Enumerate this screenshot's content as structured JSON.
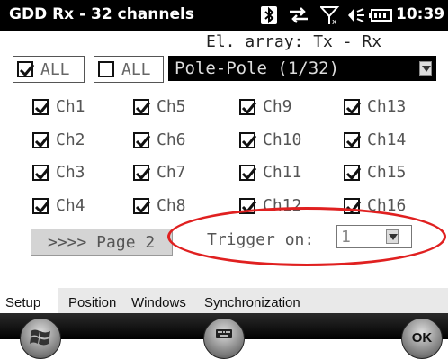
{
  "title_bar": {
    "app_title": "GDD Rx - 32 channels",
    "clock": "10:39",
    "status_icons": [
      "bluetooth-icon",
      "sync-icon",
      "signal-off-icon",
      "volume-icon",
      "battery-icon"
    ]
  },
  "header": {
    "electrode_array_label": "El. array: Tx - Rx"
  },
  "controls": {
    "all_checked_label": "ALL",
    "all_unchecked_label": "ALL",
    "array_type": "Pole-Pole (1/32)"
  },
  "channels": [
    {
      "label": "Ch1",
      "checked": true
    },
    {
      "label": "Ch2",
      "checked": true
    },
    {
      "label": "Ch3",
      "checked": true
    },
    {
      "label": "Ch4",
      "checked": true
    },
    {
      "label": "Ch5",
      "checked": true
    },
    {
      "label": "Ch6",
      "checked": true
    },
    {
      "label": "Ch7",
      "checked": true
    },
    {
      "label": "Ch8",
      "checked": true
    },
    {
      "label": "Ch9",
      "checked": true
    },
    {
      "label": "Ch10",
      "checked": true
    },
    {
      "label": "Ch11",
      "checked": true
    },
    {
      "label": "Ch12",
      "checked": true
    },
    {
      "label": "Ch13",
      "checked": true
    },
    {
      "label": "Ch14",
      "checked": true
    },
    {
      "label": "Ch15",
      "checked": true
    },
    {
      "label": "Ch16",
      "checked": true
    }
  ],
  "paging": {
    "next_page_label": ">>>> Page 2"
  },
  "trigger": {
    "label": "Trigger on:",
    "value": "1"
  },
  "tabs": [
    {
      "label": "Setup",
      "active": true
    },
    {
      "label": "Position",
      "active": false
    },
    {
      "label": "Windows",
      "active": false
    },
    {
      "label": "Synchronization",
      "active": false
    }
  ],
  "softkeys": {
    "ok_label": "OK"
  },
  "colors": {
    "annotation_ellipse": "#e02020",
    "combo_background": "#000000",
    "title_background": "#000000"
  }
}
